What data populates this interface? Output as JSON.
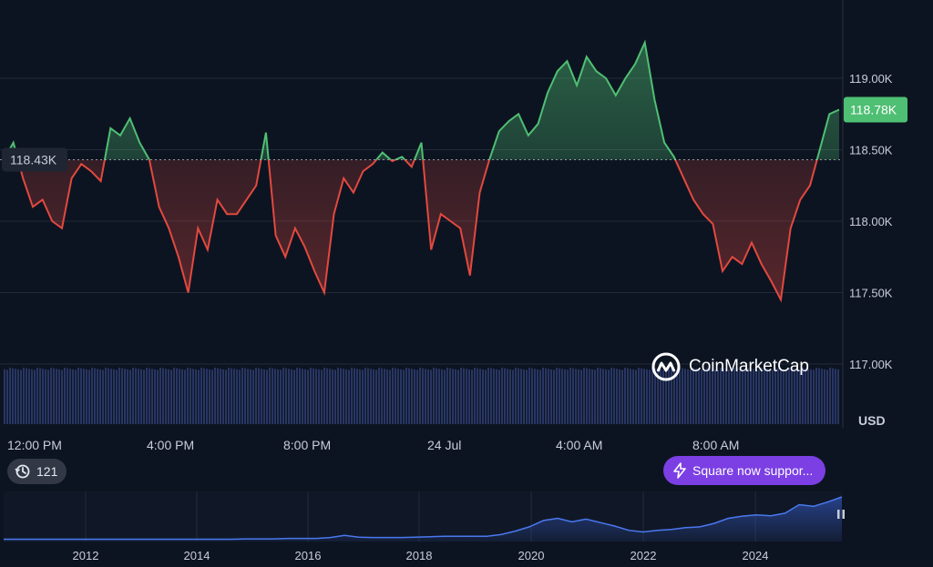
{
  "chart_data": [
    {
      "type": "line",
      "title": "",
      "currency": "USD",
      "x_ticks": [
        "12:00 PM",
        "4:00 PM",
        "8:00 PM",
        "24 Jul",
        "4:00 AM",
        "8:00 AM"
      ],
      "y_ticks": [
        "119.00K",
        "118.50K",
        "118.00K",
        "117.50K",
        "117.00K"
      ],
      "ylim": [
        117.0,
        119.5
      ],
      "baseline": 118.43,
      "baseline_label": "118.43K",
      "last_price": 118.78,
      "last_price_label": "118.78K",
      "up_color": "#4fbf73",
      "down_color": "#e2493f",
      "x": [
        0,
        2,
        4,
        6,
        8,
        10,
        12,
        14,
        16,
        18,
        20,
        22,
        24,
        26,
        28,
        30,
        32,
        34,
        36,
        38,
        40,
        42,
        44,
        46,
        48,
        50,
        52,
        54,
        56,
        58,
        60,
        62,
        64,
        66,
        68,
        70,
        72,
        74,
        76,
        78,
        80,
        82,
        84,
        86,
        88,
        90,
        92,
        94,
        96,
        98,
        100
      ],
      "values": [
        118.43,
        118.55,
        118.3,
        118.1,
        118.15,
        118.0,
        117.95,
        118.3,
        118.4,
        118.35,
        118.28,
        118.65,
        118.6,
        118.72,
        118.55,
        118.43,
        118.1,
        117.95,
        117.75,
        117.5,
        117.95,
        117.8,
        118.15,
        118.05,
        118.05,
        118.15,
        118.25,
        118.62,
        117.9,
        117.75,
        117.95,
        117.82,
        117.65,
        117.5,
        118.05,
        118.3,
        118.2,
        118.35,
        118.4,
        118.48,
        118.42,
        118.45,
        118.38,
        118.55,
        117.8,
        118.05,
        118.0,
        117.95,
        117.62,
        118.2,
        118.43
      ],
      "values_part2": [
        118.63,
        118.7,
        118.75,
        118.6,
        118.68,
        118.9,
        119.05,
        119.12,
        118.95,
        119.15,
        119.05,
        119.0,
        118.88,
        119.0,
        119.1,
        119.25,
        118.85,
        118.55,
        118.45,
        118.3,
        118.15,
        118.05,
        117.98,
        117.65,
        117.75,
        117.7,
        117.85,
        117.7,
        117.58,
        117.45,
        117.95,
        118.15,
        118.25,
        118.5,
        118.75,
        118.78
      ]
    },
    {
      "type": "area",
      "title": "",
      "x_ticks": [
        "2012",
        "2014",
        "2016",
        "2018",
        "2020",
        "2022",
        "2024"
      ],
      "values": [
        0.01,
        0.01,
        0.01,
        0.01,
        0.01,
        0.01,
        0.01,
        0.01,
        0.01,
        0.01,
        0.01,
        0.01,
        0.01,
        0.01,
        0.01,
        0.01,
        0.01,
        0.02,
        0.02,
        0.02,
        0.03,
        0.03,
        0.03,
        0.05,
        0.1,
        0.06,
        0.05,
        0.05,
        0.05,
        0.06,
        0.07,
        0.08,
        0.08,
        0.08,
        0.08,
        0.12,
        0.2,
        0.3,
        0.45,
        0.5,
        0.42,
        0.48,
        0.4,
        0.32,
        0.22,
        0.18,
        0.22,
        0.24,
        0.28,
        0.3,
        0.38,
        0.5,
        0.55,
        0.58,
        0.56,
        0.62,
        0.82,
        0.78,
        0.88,
        1.0
      ]
    }
  ],
  "watermark": {
    "brand": "CoinMarketCap"
  },
  "history_pill": {
    "count": "121"
  },
  "toast": {
    "text": "Square now suppor..."
  }
}
